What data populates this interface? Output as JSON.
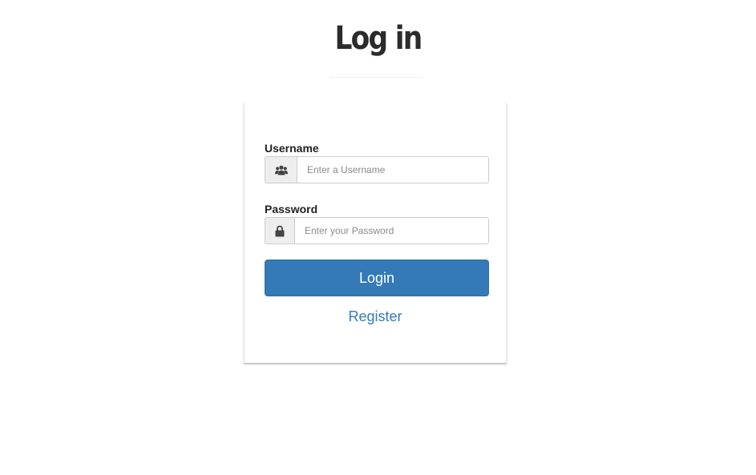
{
  "page": {
    "title": "Log in"
  },
  "form": {
    "username": {
      "label": "Username",
      "placeholder": "Enter a Username",
      "value": "",
      "icon": "users-icon"
    },
    "password": {
      "label": "Password",
      "placeholder": "Enter your Password",
      "value": "",
      "icon": "lock-icon"
    },
    "login_label": "Login",
    "register_label": "Register"
  },
  "colors": {
    "primary": "#337ab7",
    "title": "#2b2b2b"
  }
}
